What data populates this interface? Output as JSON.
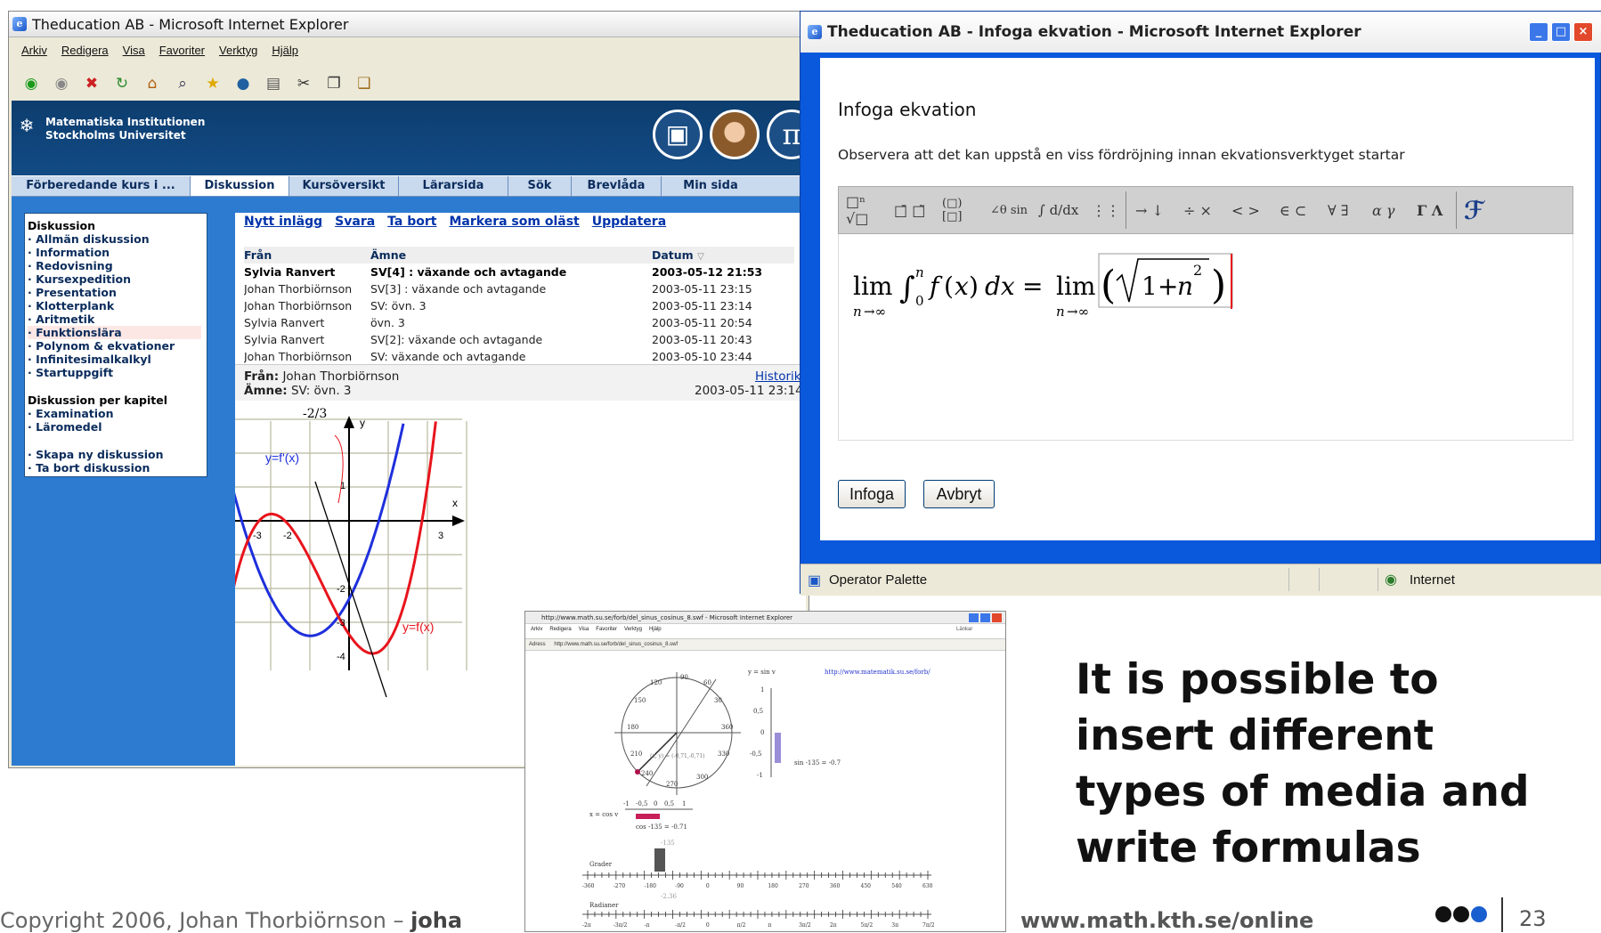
{
  "main_window": {
    "title": "Theducation AB - Microsoft Internet Explorer",
    "menu": [
      "Arkiv",
      "Redigera",
      "Visa",
      "Favoriter",
      "Verktyg",
      "Hjälp"
    ],
    "toolbar_icons": [
      "back-icon",
      "forward-icon",
      "stop-icon",
      "refresh-icon",
      "home-icon",
      "search-icon",
      "favorites-icon",
      "media-icon",
      "print-icon",
      "cut-icon",
      "copy-icon",
      "paste-icon"
    ],
    "header": {
      "line1": "Matematiska Institutionen",
      "line2": "Stockholms Universitet"
    },
    "nav_tabs": [
      "Förberedande kurs i ...",
      "Diskussion",
      "Kursöversikt",
      "Lärarsida",
      "Sök",
      "Brevlåda",
      "Min sida"
    ],
    "sidebar": {
      "section1_title": "Diskussion",
      "section1_items": [
        "Allmän diskussion",
        "Information",
        "Redovisning",
        "Kursexpedition",
        "Presentation",
        "Klotterplank",
        "Aritmetik",
        "Funktionslära",
        "Polynom & ekvationer",
        "Infinitesimalkalkyl",
        "Startuppgift"
      ],
      "section2_title": "Diskussion per kapitel",
      "section2_items": [
        "Examination",
        "Läromedel"
      ],
      "section3_items": [
        "Skapa ny diskussion",
        "Ta bort diskussion"
      ]
    },
    "actions": [
      "Nytt inlägg",
      "Svara",
      "Ta bort",
      "Markera som oläst",
      "Uppdatera"
    ],
    "table_headers": [
      "Från",
      "Ämne",
      "Datum"
    ],
    "rows": [
      {
        "from": "Sylvia Ranvert",
        "subject": "SV[4] : växande och avtagande",
        "date": "2003-05-12 21:53",
        "bold": true
      },
      {
        "from": "Johan Thorbiörnson",
        "subject": "SV[3] : växande och avtagande",
        "date": "2003-05-11 23:15"
      },
      {
        "from": "Johan Thorbiörnson",
        "subject": "SV: övn. 3",
        "date": "2003-05-11 23:14"
      },
      {
        "from": "Sylvia Ranvert",
        "subject": "övn. 3",
        "date": "2003-05-11 20:54"
      },
      {
        "from": "Sylvia Ranvert",
        "subject": "SV[2]: växande och avtagande",
        "date": "2003-05-11 20:43"
      },
      {
        "from": "Johan Thorbiörnson",
        "subject": "SV: växande och avtagande",
        "date": "2003-05-10 23:44"
      }
    ],
    "message": {
      "from_label": "Från:",
      "from": "Johan Thorbiörnson",
      "subject_label": "Ämne:",
      "subject": "SV: övn. 3",
      "history_link": "Historik",
      "date": "2003-05-11 23:14"
    },
    "graph": {
      "annotation": "-2/3",
      "y_label": "y",
      "x_label": "x",
      "fprime_label": "y=f'(x)",
      "f_label": "y=f(x)",
      "x_ticks": [
        "-3",
        "-2",
        "3"
      ],
      "y_ticks": [
        "1",
        "-2",
        "-3",
        "-4"
      ],
      "colors": {
        "fprime": "#1e2fdc",
        "f": "#e8141c"
      }
    }
  },
  "dialog": {
    "title": "Theducation AB - Infoga ekvation - Microsoft Internet Explorer",
    "heading": "Infoga ekvation",
    "notice": "Observera att det kan uppstå en viss fördröjning innan ekvationsverktyget startar",
    "palette": [
      "□ⁿ √□",
      "□̄ □̃",
      "(□) [□]",
      "∠θ sin",
      "∫ d/dx",
      "⋮⋮",
      "→ ↓",
      "÷ ×",
      "< >",
      "∈ ⊂",
      "∀ ∃",
      "α γ",
      "Γ Λ"
    ],
    "insert_button": "Infoga",
    "cancel_button": "Avbryt",
    "status_left": "Operator Palette",
    "status_right": "Internet"
  },
  "flash_window": {
    "title": "http://www.math.su.se/forb/del_sinus_cosinus_8.swf - Microsoft Internet Explorer",
    "menu": [
      "Arkiv",
      "Redigera",
      "Visa",
      "Favoriter",
      "Verktyg",
      "Hjälp"
    ],
    "address_label": "Adress",
    "address": "http://www.math.su.se/forb/del_sinus_cosinus_8.swf",
    "links_label": "Länkar",
    "site_link": "http://www.matematik.su.se/forb/",
    "y_caption": "y = sin v",
    "x_caption": "x = cos v",
    "sin_text": "sin -135 = -0.7",
    "cos_text": "cos -135 = -0.71",
    "degree_value": "-135",
    "radian_value": "-2.36",
    "circle_labels": [
      "120",
      "90",
      "60",
      "150",
      "30",
      "180",
      "360",
      "210",
      "330",
      "240",
      "270",
      "300"
    ],
    "sin_ticks": [
      "1",
      "0,5",
      "0",
      "-0,5",
      "-1"
    ],
    "cos_ticks": [
      "-1",
      "-0,5",
      "0",
      "0,5",
      "1"
    ],
    "point_label": "(x, y) = (-0,71,-0,71)",
    "grader_label": "Grader",
    "radianer_label": "Radianer",
    "deg_ticks": [
      "-360",
      "-270",
      "-180",
      "-90",
      "0",
      "90",
      "180",
      "270",
      "360",
      "450",
      "540",
      "630"
    ],
    "rad_ticks": [
      "-2π",
      "-3π/2",
      "-π",
      "-π/2",
      "0",
      "π/2",
      "π",
      "3π/2",
      "2π",
      "5π/2",
      "3π",
      "7π/2"
    ]
  },
  "slide": {
    "caption_lines": [
      "It is possible to",
      "insert different",
      "types of media and",
      "write formulas"
    ],
    "footer_left": "Copyright 2006, Johan Thorbiörnson – ",
    "footer_bold": "joha",
    "footer_url": "www.math.kth.se/online",
    "page_number": "23"
  }
}
